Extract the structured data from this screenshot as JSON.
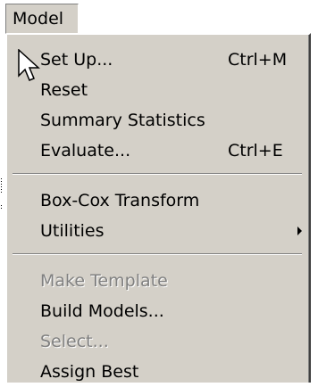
{
  "menubar": {
    "active_menu": "Model"
  },
  "menu": {
    "items": [
      {
        "label": "Set Up...",
        "shortcut": "Ctrl+M",
        "enabled": true
      },
      {
        "label": "Reset",
        "shortcut": "",
        "enabled": true
      },
      {
        "label": "Summary Statistics",
        "shortcut": "",
        "enabled": true
      },
      {
        "label": "Evaluate...",
        "shortcut": "Ctrl+E",
        "enabled": true
      },
      {
        "label": "Box-Cox Transform",
        "shortcut": "",
        "enabled": true
      },
      {
        "label": "Utilities",
        "shortcut": "",
        "enabled": true,
        "submenu": true
      },
      {
        "label": "Make Template",
        "shortcut": "",
        "enabled": false
      },
      {
        "label": "Build Models...",
        "shortcut": "",
        "enabled": true
      },
      {
        "label": "Select...",
        "shortcut": "",
        "enabled": false
      },
      {
        "label": "Assign Best",
        "shortcut": "",
        "enabled": true
      }
    ]
  },
  "colors": {
    "menu_background": "#d4d0c8",
    "text": "#000000",
    "disabled_text": "#808080"
  },
  "icons": {
    "cursor": "arrow-cursor-icon",
    "submenu": "submenu-arrow-icon"
  }
}
